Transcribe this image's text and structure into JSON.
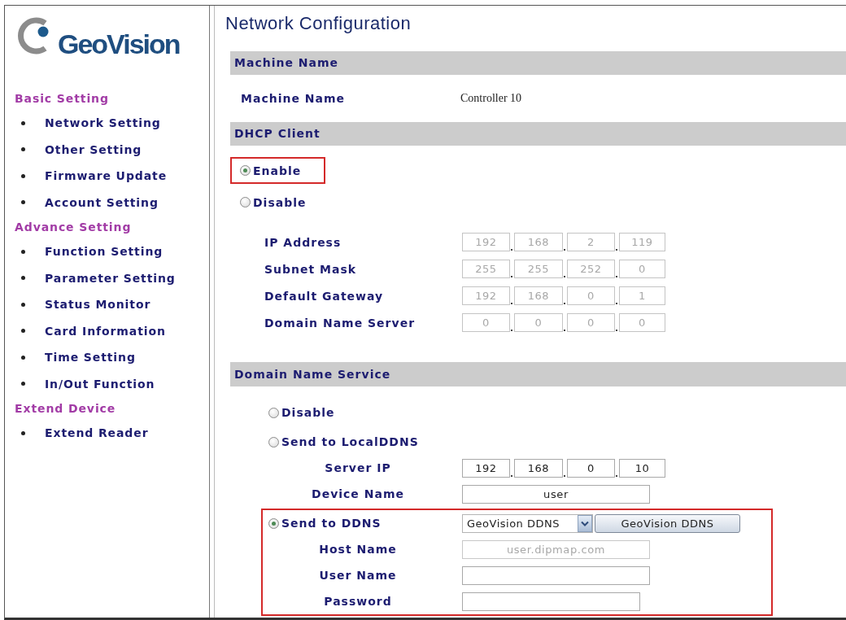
{
  "sidebar": {
    "logo": "GeoVision",
    "sections": [
      {
        "title": "Basic Setting",
        "items": [
          "Network Setting",
          "Other Setting",
          "Firmware Update",
          "Account Setting"
        ]
      },
      {
        "title": "Advance Setting",
        "items": [
          "Function Setting",
          "Parameter Setting",
          "Status Monitor",
          "Card Information",
          "Time Setting",
          "In/Out Function"
        ]
      },
      {
        "title": "Extend Device",
        "items": [
          "Extend Reader"
        ]
      }
    ]
  },
  "title": "Network Configuration",
  "machine_name": {
    "header": "Machine Name",
    "label": "Machine Name",
    "value": "Controller 10"
  },
  "dhcp_client": {
    "header": "DHCP Client",
    "options": [
      {
        "label": "Enable",
        "selected": true,
        "highlighted": true
      },
      {
        "label": "Disable",
        "selected": false,
        "highlighted": false
      }
    ],
    "fields": [
      {
        "label": "IP Address",
        "octets": [
          "192",
          "168",
          "2",
          "119"
        ],
        "disabled": true
      },
      {
        "label": "Subnet Mask",
        "octets": [
          "255",
          "255",
          "252",
          "0"
        ],
        "disabled": true
      },
      {
        "label": "Default Gateway",
        "octets": [
          "192",
          "168",
          "0",
          "1"
        ],
        "disabled": true
      },
      {
        "label": "Domain Name Server",
        "octets": [
          "0",
          "0",
          "0",
          "0"
        ],
        "disabled": true
      }
    ]
  },
  "domain_name_service": {
    "header": "Domain Name Service",
    "options": [
      {
        "label": "Disable",
        "selected": false,
        "highlighted": false
      },
      {
        "label": "Send to LocalDDNS",
        "selected": false,
        "highlighted": false,
        "fields": [
          {
            "kind": "ip",
            "label": "Server IP",
            "octets": [
              "192",
              "168",
              "0",
              "10"
            ],
            "disabled": false
          },
          {
            "kind": "text",
            "label": "Device Name",
            "value": "user",
            "disabled": false
          }
        ]
      },
      {
        "label": "Send to DDNS",
        "selected": true,
        "highlighted": true,
        "provider": {
          "select": "GeoVision DDNS",
          "button": "GeoVision DDNS"
        },
        "fields": [
          {
            "kind": "text",
            "label": "Host Name",
            "value": "user.dipmap.com",
            "disabled": true
          },
          {
            "kind": "text",
            "label": "User Name",
            "disabled": false
          },
          {
            "kind": "password",
            "label": "Password",
            "disabled": false
          }
        ]
      }
    ]
  }
}
